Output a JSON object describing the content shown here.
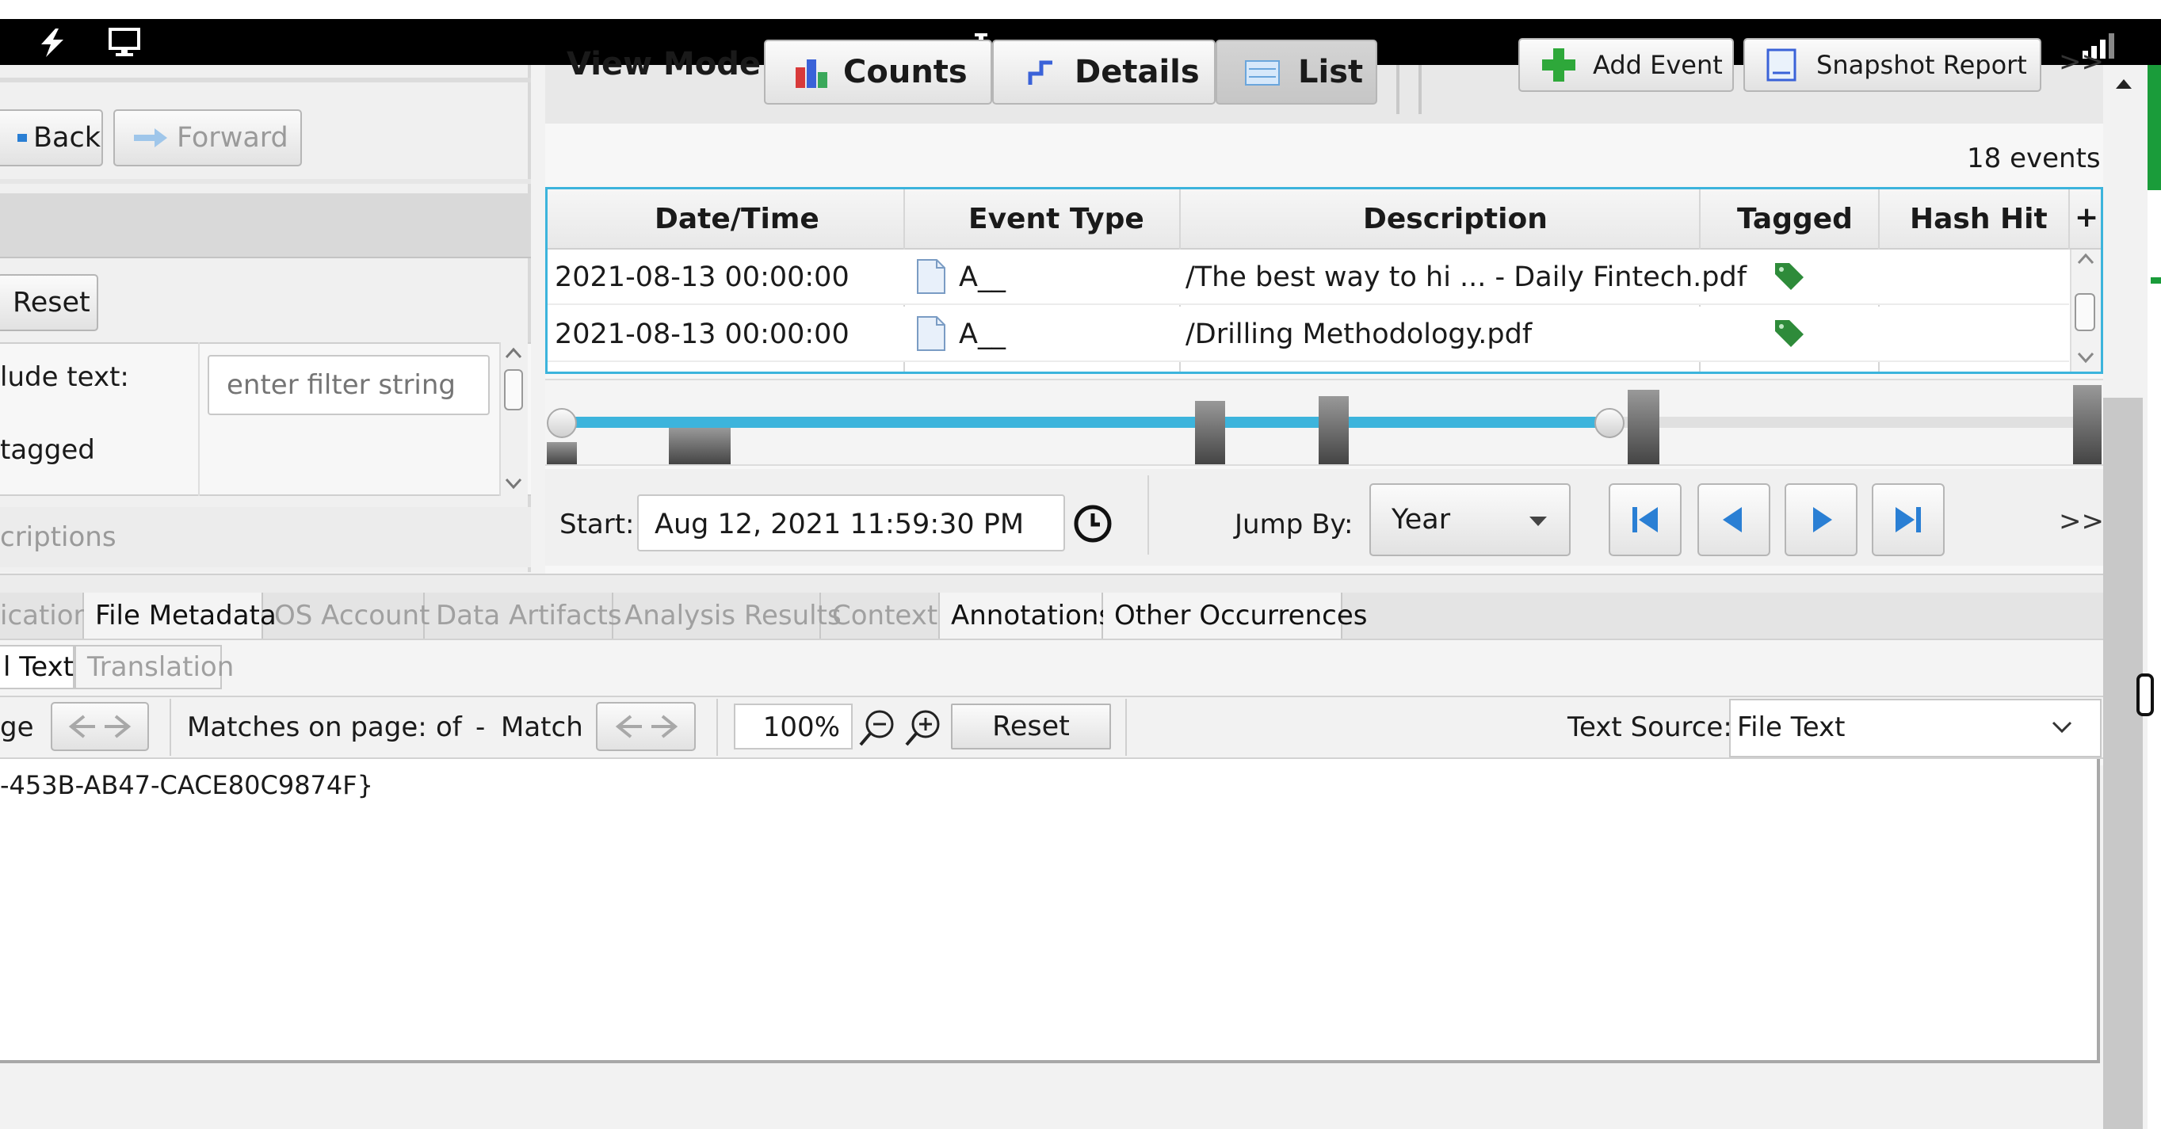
{
  "toolbar": {
    "view_mode_label": "View Mode:",
    "mode_counts": "Counts",
    "mode_details": "Details",
    "mode_list": "List",
    "add_event": "Add Event",
    "snapshot_report": "Snapshot Report",
    "overflow": ">>"
  },
  "history": {
    "back": "Back",
    "forward": "Forward"
  },
  "filters": {
    "reset": "Reset",
    "text_filter_label": "lude text:",
    "text_filter_placeholder": "enter filter string",
    "tagged_label": "tagged",
    "descriptions_label": "criptions"
  },
  "events": {
    "count": "18 events",
    "columns": [
      "Date/Time",
      "Event Type",
      "Description",
      "Tagged",
      "Hash Hit",
      "+"
    ],
    "rows": [
      {
        "datetime": "2021-08-13 00:00:00",
        "type": "A__",
        "description": "/The best way to hi ... - Daily Fintech.pdf",
        "tagged": true
      },
      {
        "datetime": "2021-08-13 00:00:00",
        "type": "A__",
        "description": "/Drilling Methodology.pdf",
        "tagged": true
      }
    ]
  },
  "timeline": {
    "start_label": "Start:",
    "start_value": "Aug 12, 2021 11:59:30 PM",
    "jump_by_label": "Jump By:",
    "jump_by_value": "Year",
    "overflow": ">>"
  },
  "viewer_tabs": [
    "ication",
    "File Metadata",
    "OS Account",
    "Data Artifacts",
    "Analysis Results",
    "Context",
    "Annotations",
    "Other Occurrences"
  ],
  "sub_tabs": [
    "l Text",
    "Translation"
  ],
  "text_toolbar": {
    "page_label": "ge",
    "matches_label": "Matches on page:",
    "matches_current": "-",
    "of": "of",
    "matches_total": "-",
    "match_label": "Match",
    "zoom": "100%",
    "reset": "Reset",
    "text_source_label": "Text Source:",
    "text_source_value": "File Text"
  },
  "content": {
    "text": "-453B-AB47-CACE80C9874F}"
  },
  "colors": {
    "accent": "#3cb4dc",
    "tag_green": "#2e8b3a",
    "window_green": "#1a9c3a"
  }
}
